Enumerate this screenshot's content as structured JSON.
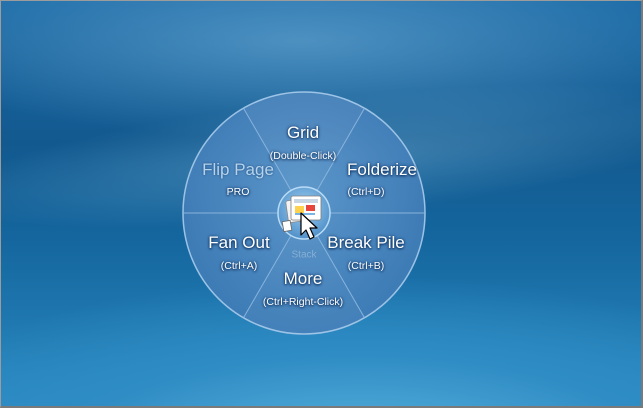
{
  "menu": {
    "center_hint": "Stack",
    "segments": [
      {
        "label": "Grid",
        "shortcut": "(Double-Click)"
      },
      {
        "label": "Folderize",
        "shortcut": "(Ctrl+D)"
      },
      {
        "label": "Break Pile",
        "shortcut": "(Ctrl+B)"
      },
      {
        "label": "More",
        "shortcut": "(Ctrl+Right-Click)"
      },
      {
        "label": "Fan Out",
        "shortcut": "(Ctrl+A)"
      },
      {
        "label": "Flip Page",
        "shortcut": "PRO"
      }
    ]
  },
  "icons": {
    "center": "file-pile-icon",
    "pointer": "mouse-pointer-icon"
  }
}
